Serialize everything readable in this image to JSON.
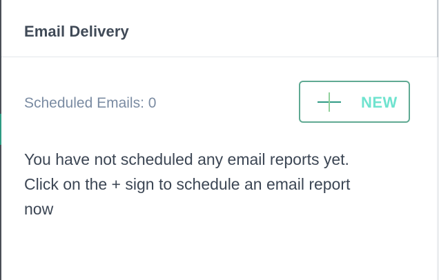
{
  "panel": {
    "title": "Email Delivery"
  },
  "scheduled": {
    "label": "Scheduled Emails: 0"
  },
  "new_button": {
    "label": "NEW",
    "icon": "plus-icon"
  },
  "empty_state": {
    "lines": [
      "You have not scheduled any email reports yet.",
      "Click on the + sign to schedule an email report",
      "now"
    ]
  },
  "colors": {
    "title": "#404a57",
    "label": "#7a8ba2",
    "button_border": "#5fa992",
    "button_text": "#6fe3cf",
    "plus_horizontal": "#2f9a84",
    "plus_vertical": "#8fd19b",
    "body_text": "#3c4654"
  }
}
